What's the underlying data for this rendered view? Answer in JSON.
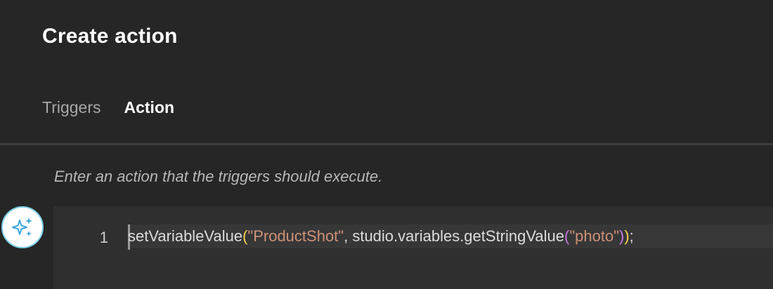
{
  "dialog": {
    "title": "Create action"
  },
  "tabs": [
    {
      "label": "Triggers",
      "active": false
    },
    {
      "label": "Action",
      "active": true
    }
  ],
  "hint": "Enter an action that the triggers should execute.",
  "editor": {
    "line_number": "1",
    "tokens": {
      "fn": "setVariableValue",
      "open1": "(",
      "arg1": "\"ProductShot\"",
      "comma": ", studio.variables.getStringValue",
      "open2": "(",
      "arg2": "\"photo\"",
      "close2": ")",
      "close1": ")",
      "end": ";"
    }
  },
  "ai_button": {
    "icon": "sparkles-icon"
  },
  "colors": {
    "background": "#262626",
    "editor_background": "#2f2f2f",
    "string": "#ce9178",
    "paren_outer": "#f7d54a",
    "paren_inner": "#c678dd",
    "ai_border": "#7ccfe8",
    "ai_sparkle": "#3aa6dd"
  }
}
